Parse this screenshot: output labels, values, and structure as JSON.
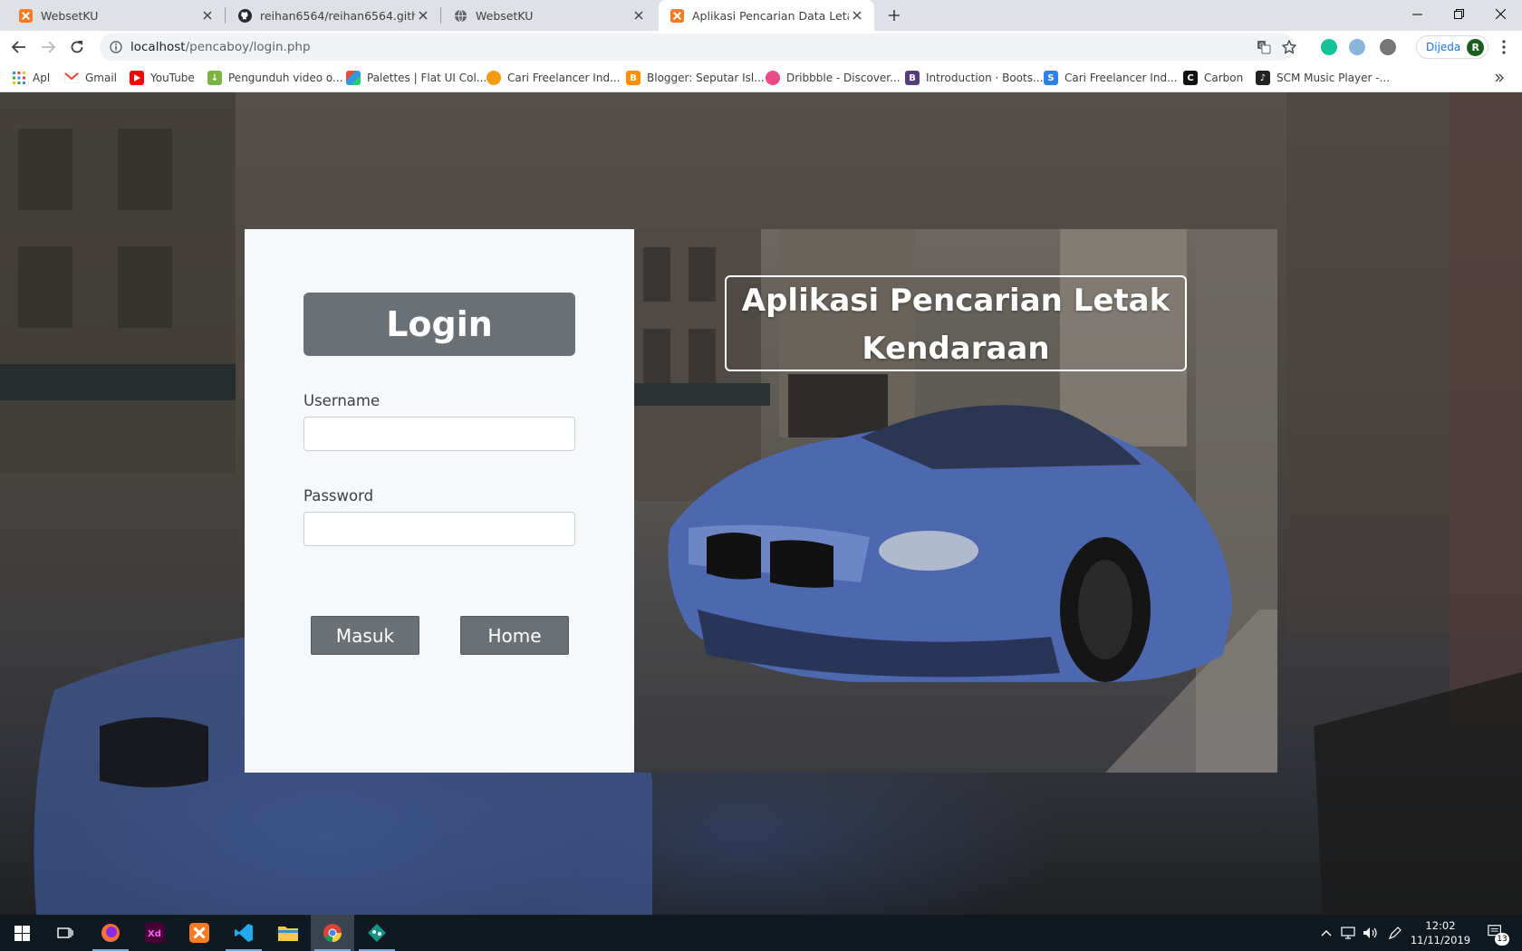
{
  "browser": {
    "tabs": [
      {
        "title": "WebsetKU",
        "icon": "xampp-icon",
        "active": false
      },
      {
        "title": "reihan6564/reihan6564.github.io",
        "icon": "github-icon",
        "active": false
      },
      {
        "title": "WebsetKU",
        "icon": "globe-icon",
        "active": false
      },
      {
        "title": "Aplikasi Pencarian Data Letak Ke",
        "icon": "xampp-icon",
        "active": true
      }
    ],
    "url_host": "localhost",
    "url_path": "/pencaboy/login.php",
    "paused_label": "Dijeda",
    "avatar_initial": "R"
  },
  "bookmarks": [
    {
      "label": "Apl",
      "icon": "apps-grid-icon"
    },
    {
      "label": "Gmail",
      "icon": "gmail-icon"
    },
    {
      "label": "YouTube",
      "icon": "youtube-icon"
    },
    {
      "label": "Pengunduh video o...",
      "icon": "downloader-icon"
    },
    {
      "label": "Palettes | Flat UI Col...",
      "icon": "palette-icon"
    },
    {
      "label": "Cari Freelancer Ind...",
      "icon": "freelancer-icon"
    },
    {
      "label": "Blogger: Seputar Isl...",
      "icon": "blogger-icon"
    },
    {
      "label": "Dribbble - Discover...",
      "icon": "dribbble-icon"
    },
    {
      "label": "Introduction · Boots...",
      "icon": "bootstrap-icon"
    },
    {
      "label": "Cari Freelancer Ind...",
      "icon": "sribulancer-icon"
    },
    {
      "label": "Carbon",
      "icon": "carbon-icon"
    },
    {
      "label": "SCM Music Player -...",
      "icon": "music-icon"
    }
  ],
  "login": {
    "title": "Login",
    "username_label": "Username",
    "username_value": "",
    "password_label": "Password",
    "password_value": "",
    "submit_label": "Masuk",
    "home_label": "Home"
  },
  "hero": {
    "title": "Aplikasi Pencarian Letak Kendaraan"
  },
  "taskbar": {
    "time": "12:02",
    "date": "11/11/2019",
    "notification_count": "13"
  }
}
